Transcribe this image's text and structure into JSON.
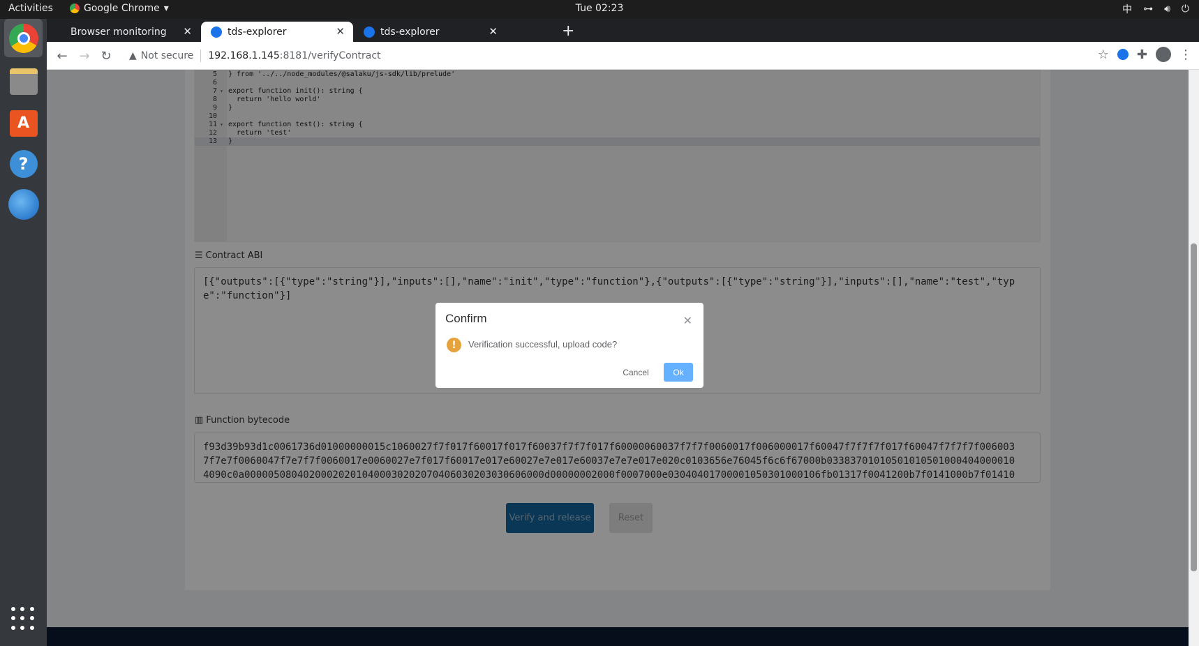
{
  "system": {
    "activities": "Activities",
    "app_name": "Google Chrome",
    "clock": "Tue 02:23",
    "input_method": "中"
  },
  "tabs": [
    {
      "label": "Browser monitoring",
      "active": false
    },
    {
      "label": "tds-explorer",
      "active": true
    },
    {
      "label": "tds-explorer",
      "active": false
    }
  ],
  "address": {
    "security": "Not secure",
    "host": "192.168.1.145",
    "path": ":8181/verifyContract"
  },
  "editor": {
    "lines": [
      {
        "n": "5",
        "text": "} from '../../node_modules/@salaku/js-sdk/lib/prelude'"
      },
      {
        "n": "6",
        "text": ""
      },
      {
        "n": "7",
        "text": "export function init(): string {"
      },
      {
        "n": "8",
        "text": "  return 'hello world'"
      },
      {
        "n": "9",
        "text": "}"
      },
      {
        "n": "10",
        "text": ""
      },
      {
        "n": "11",
        "text": "export function test(): string {"
      },
      {
        "n": "12",
        "text": "  return 'test'"
      },
      {
        "n": "13",
        "text": "}"
      }
    ]
  },
  "abi": {
    "label": "Contract ABI",
    "value": "[{\"outputs\":[{\"type\":\"string\"}],\"inputs\":[],\"name\":\"init\",\"type\":\"function\"},{\"outputs\":[{\"type\":\"string\"}],\"inputs\":[],\"name\":\"test\",\"type\":\"function\"}]"
  },
  "bytecode": {
    "label": "Function bytecode",
    "value": "f93d39b93d1c0061736d01000000015c1060027f7f017f60017f017f60037f7f7f017f60000060037f7f7f0060017f006000017f60047f7f7f7f017f60047f7f7f7f0060037f7e7f0060047f7e7f7f0060017e0060027e7f017f60017e017e60027e7e017e60037e7e7e017e020c0103656e76045f6c6f67000b033837010105010105010004040000104090c0a000005080402000202010400030202070406030203030606000d00000002000f0007000e03040401700001050301000106fb01317f0041200b7f0141000b7f01410"
  },
  "actions": {
    "verify": "Verify and release",
    "reset": "Reset"
  },
  "dialog": {
    "title": "Confirm",
    "message": "Verification successful, upload code?",
    "cancel": "Cancel",
    "ok": "Ok",
    "warning_color": "#e6a23c",
    "ok_color": "#66b1ff"
  }
}
